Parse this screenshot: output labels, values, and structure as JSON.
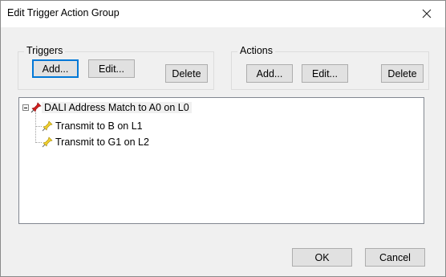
{
  "window": {
    "title": "Edit Trigger Action Group"
  },
  "triggers": {
    "label": "Triggers",
    "add": "Add...",
    "edit": "Edit...",
    "delete": "Delete"
  },
  "actions": {
    "label": "Actions",
    "add": "Add...",
    "edit": "Edit...",
    "delete": "Delete"
  },
  "tree": {
    "root": "DALI Address Match to A0 on L0",
    "children": [
      "Transmit to B on L1",
      "Transmit to G1 on L2"
    ]
  },
  "footer": {
    "ok": "OK",
    "cancel": "Cancel"
  },
  "icons": {
    "trigger": "red-pushpin-icon",
    "action": "yellow-pushpin-icon",
    "close": "close-icon"
  },
  "colors": {
    "focus": "#0078d7",
    "trigger_icon": "#d32020",
    "action_icon": "#e8c200"
  }
}
